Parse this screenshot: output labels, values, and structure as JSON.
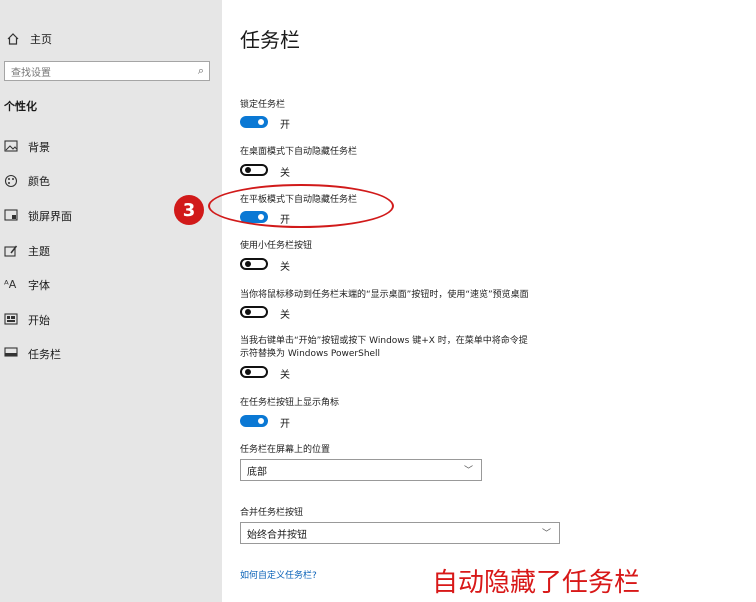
{
  "sidebar": {
    "home_label": "主页",
    "search_placeholder": "查找设置",
    "section_title": "个性化",
    "items": [
      {
        "label": "背景",
        "icon": "picture-icon"
      },
      {
        "label": "颜色",
        "icon": "palette-icon"
      },
      {
        "label": "锁屏界面",
        "icon": "lockscreen-icon"
      },
      {
        "label": "主题",
        "icon": "theme-brush-icon"
      },
      {
        "label": "字体",
        "icon": "font-icon"
      },
      {
        "label": "开始",
        "icon": "start-icon"
      },
      {
        "label": "任务栏",
        "icon": "taskbar-icon"
      }
    ]
  },
  "main": {
    "title": "任务栏",
    "settings": [
      {
        "label": "锁定任务栏",
        "state": "开"
      },
      {
        "label": "在桌面模式下自动隐藏任务栏",
        "state": "关"
      },
      {
        "label": "在平板模式下自动隐藏任务栏",
        "state": "开"
      },
      {
        "label": "使用小任务栏按钮",
        "state": "关"
      },
      {
        "label": "当你将鼠标移动到任务栏末端的“显示桌面”按钮时，使用“速览”预览桌面",
        "state": "关"
      },
      {
        "label": "当我右键单击“开始”按钮或按下 Windows 键+X 时，在菜单中将命令提",
        "label2": "示符替换为 Windows PowerShell",
        "state": "关"
      },
      {
        "label": "在任务栏按钮上显示角标",
        "state": "开"
      }
    ],
    "position": {
      "label": "任务栏在屏幕上的位置",
      "value": "底部"
    },
    "combine": {
      "label": "合并任务栏按钮",
      "value": "始终合并按钮"
    },
    "help_link": "如何自定义任务栏?"
  },
  "annotation": {
    "step_number": "3",
    "caption": "自动隐藏了任务栏",
    "color": "#d11a1a"
  },
  "colors": {
    "accent": "#0a78d4",
    "sidebar_bg": "#e6e6e6"
  }
}
